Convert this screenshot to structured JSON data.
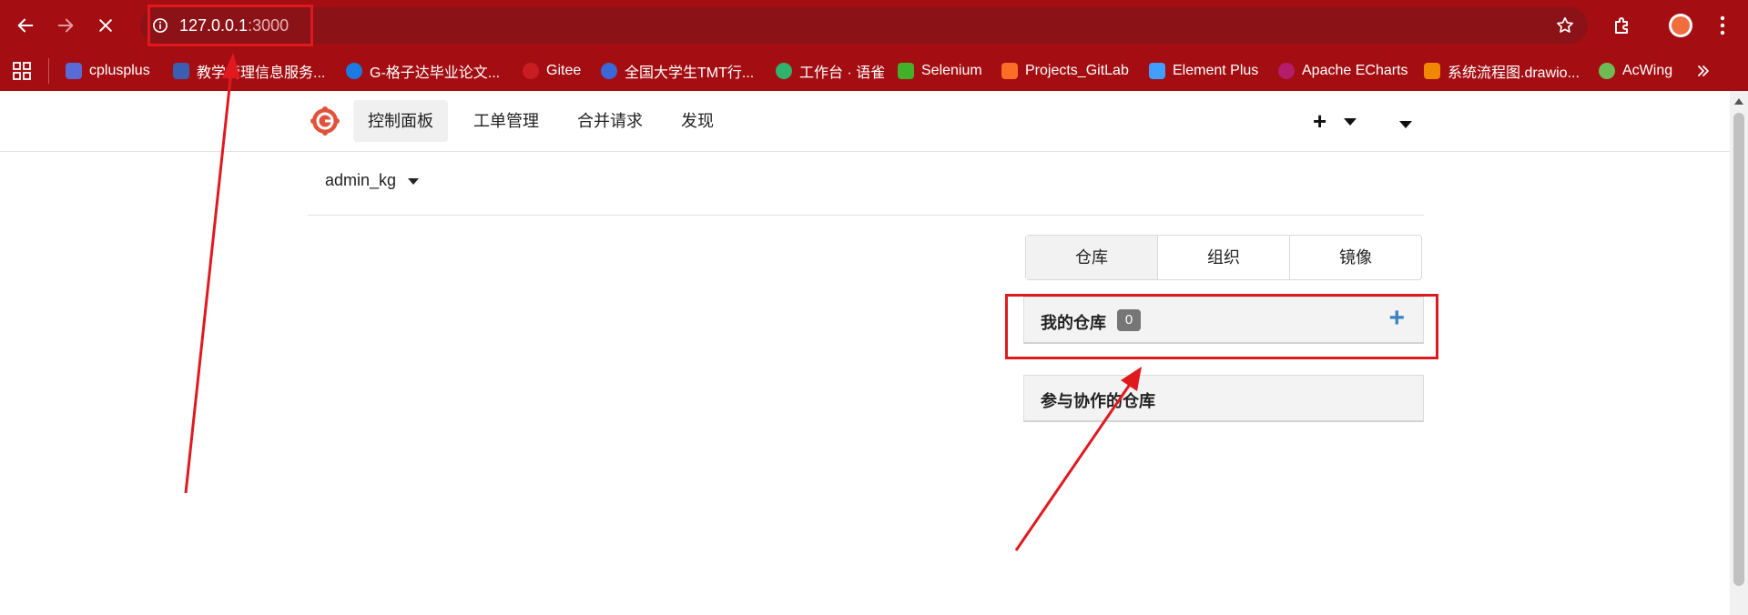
{
  "browser": {
    "url_host": "127.0.0.1",
    "url_port": ":3000",
    "bookmarks": [
      {
        "label": "cplusplus",
        "color": "#5b6bd6"
      },
      {
        "label": "教学管理信息服务...",
        "color": "#3b5fb0"
      },
      {
        "label": "G-格子达毕业论文...",
        "color": "#1a7ce0"
      },
      {
        "label": "Gitee",
        "color": "#c71d23"
      },
      {
        "label": "全国大学生TMT行...",
        "color": "#3a68d8"
      },
      {
        "label": "工作台 · 语雀",
        "color": "#31b36b"
      },
      {
        "label": "Selenium",
        "color": "#43b02a"
      },
      {
        "label": "Projects_GitLab",
        "color": "#fc6d26"
      },
      {
        "label": "Element Plus",
        "color": "#409eff"
      },
      {
        "label": "Apache ECharts",
        "color": "#b51d6a"
      },
      {
        "label": "系统流程图.drawio...",
        "color": "#f08705"
      },
      {
        "label": "AcWing",
        "color": "#6fba55"
      }
    ]
  },
  "header": {
    "nav": [
      "控制面板",
      "工单管理",
      "合并请求",
      "发现"
    ],
    "plus_label": "+"
  },
  "context": {
    "user": "admin_kg"
  },
  "tabs": [
    "仓库",
    "组织",
    "镜像"
  ],
  "panels": {
    "my_repos": {
      "title": "我的仓库",
      "count": "0",
      "add": "+"
    },
    "collab_repos": {
      "title": "参与协作的仓库"
    }
  },
  "colors": {
    "chrome": "#a40e12",
    "annotation": "#e0191f",
    "accent": "#3b82c4"
  }
}
